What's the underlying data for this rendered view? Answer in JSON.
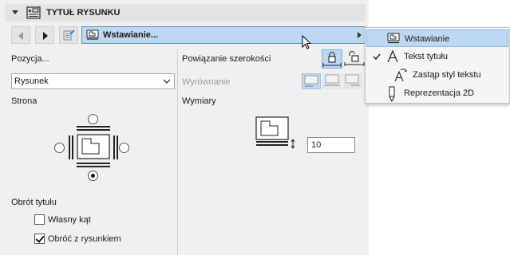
{
  "header": {
    "title": "TYTUŁ RYSUNKU"
  },
  "toolbar": {
    "selected_option": "Wstawianie..."
  },
  "left": {
    "position_label": "Pozycja...",
    "position_select_value": "Rysunek",
    "side_label": "Strona",
    "rotation_label": "Obrót tytułu",
    "custom_angle_label": "Własny kąt",
    "custom_angle_checked": false,
    "rotate_with_drawing_label": "Obróć z rysunkiem",
    "rotate_with_drawing_checked": true,
    "side_selected": "bottom"
  },
  "right": {
    "width_link_label": "Powiązanie szerokości",
    "alignment_label": "Wyrównanie",
    "dimensions_label": "Wymiary",
    "dimension_value": "10"
  },
  "menu": {
    "items": [
      {
        "label": "Wstawianie",
        "icon": "drawing-frame-icon",
        "selected": true,
        "checked": false
      },
      {
        "label": "Tekst tytułu",
        "icon": "text-a-icon",
        "selected": false,
        "checked": true
      },
      {
        "label": "Zastąp styl tekstu",
        "icon": "text-style-override-icon",
        "selected": false,
        "checked": false
      },
      {
        "label": "Reprezentacja 2D",
        "icon": "pen-icon",
        "selected": false,
        "checked": false
      }
    ]
  },
  "colors": {
    "panel_bg": "#f0f0f0",
    "selection_bg": "#bcd8f3",
    "selection_border": "#4d8fd1"
  }
}
